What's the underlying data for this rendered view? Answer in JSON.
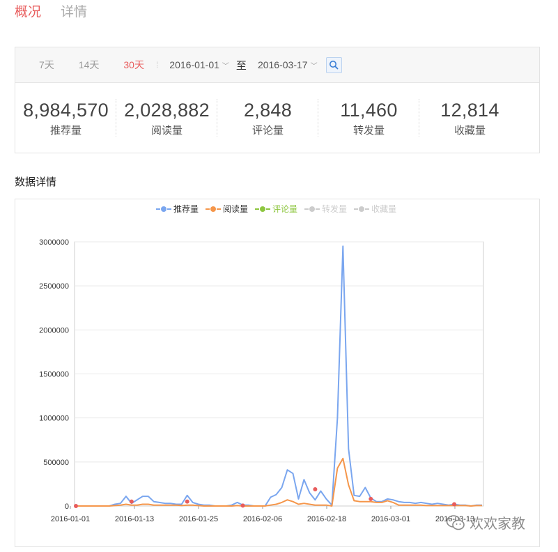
{
  "tabs": [
    {
      "label": "概况",
      "active": true
    },
    {
      "label": "详情",
      "active": false
    }
  ],
  "filter": {
    "ranges": [
      {
        "label": "7天",
        "active": false
      },
      {
        "label": "14天",
        "active": false
      },
      {
        "label": "30天",
        "active": true
      }
    ],
    "start_date": "2016-01-01",
    "to_label": "至",
    "end_date": "2016-03-17"
  },
  "metrics": [
    {
      "value": "8,984,570",
      "label": "推荐量"
    },
    {
      "value": "2,028,882",
      "label": "阅读量"
    },
    {
      "value": "2,848",
      "label": "评论量"
    },
    {
      "value": "11,460",
      "label": "转发量"
    },
    {
      "value": "12,814",
      "label": "收藏量"
    }
  ],
  "section_title": "数据详情",
  "watermark": "欢欢家教",
  "colors": {
    "accent": "#e85c5c",
    "blue": "#7aa6ef",
    "orange": "#f5964a",
    "green": "#8dc63f",
    "gray": "#cccccc",
    "marker": "#e85c5c"
  },
  "chart_data": {
    "type": "line",
    "x_ticks": [
      "2016-01-01",
      "2016-01-13",
      "2016-01-25",
      "2016-02-06",
      "2016-02-18",
      "2016-03-01",
      "2016-03-13"
    ],
    "ylim": [
      0,
      3000000
    ],
    "y_ticks": [
      "0",
      "500000",
      "1000000",
      "1500000",
      "2000000",
      "2500000",
      "3000000"
    ],
    "grid": true,
    "legend_position": "top",
    "series": [
      {
        "name": "推荐量",
        "color": "#7aa6ef",
        "visible": true,
        "values": [
          0,
          0,
          0,
          0,
          0,
          0,
          0,
          20000,
          30000,
          110000,
          30000,
          70000,
          110000,
          110000,
          50000,
          40000,
          30000,
          30000,
          20000,
          20000,
          120000,
          40000,
          20000,
          10000,
          10000,
          0,
          0,
          0,
          10000,
          40000,
          10000,
          10000,
          0,
          0,
          0,
          100000,
          130000,
          210000,
          410000,
          370000,
          80000,
          300000,
          150000,
          70000,
          170000,
          80000,
          10000,
          1000000,
          2950000,
          650000,
          120000,
          110000,
          210000,
          90000,
          50000,
          50000,
          80000,
          70000,
          50000,
          40000,
          40000,
          30000,
          40000,
          30000,
          20000,
          30000,
          20000,
          10000,
          20000,
          10000,
          10000,
          0,
          10000,
          10000
        ]
      },
      {
        "name": "阅读量",
        "color": "#f5964a",
        "visible": true,
        "values": [
          0,
          0,
          0,
          0,
          0,
          0,
          0,
          5000,
          10000,
          20000,
          10000,
          10000,
          20000,
          20000,
          10000,
          10000,
          10000,
          10000,
          10000,
          5000,
          10000,
          10000,
          5000,
          0,
          0,
          0,
          0,
          0,
          0,
          5000,
          0,
          0,
          0,
          0,
          0,
          10000,
          20000,
          40000,
          70000,
          50000,
          20000,
          30000,
          20000,
          10000,
          10000,
          10000,
          0,
          430000,
          540000,
          240000,
          60000,
          50000,
          50000,
          50000,
          40000,
          40000,
          60000,
          40000,
          10000,
          10000,
          10000,
          10000,
          10000,
          5000,
          5000,
          5000,
          5000,
          5000,
          5000,
          5000,
          5000,
          0,
          5000,
          5000
        ]
      },
      {
        "name": "评论量",
        "color": "#8dc63f",
        "visible": true,
        "values": []
      },
      {
        "name": "转发量",
        "color": "#cccccc",
        "visible": false,
        "values": []
      },
      {
        "name": "收藏量",
        "color": "#cccccc",
        "visible": false,
        "values": []
      }
    ],
    "markers": [
      {
        "x": 0,
        "y": 0
      },
      {
        "x": 10,
        "y": 50000
      },
      {
        "x": 20,
        "y": 50000
      },
      {
        "x": 30,
        "y": 5000
      },
      {
        "x": 43,
        "y": 190000
      },
      {
        "x": 53,
        "y": 80000
      },
      {
        "x": 68,
        "y": 20000
      }
    ]
  }
}
